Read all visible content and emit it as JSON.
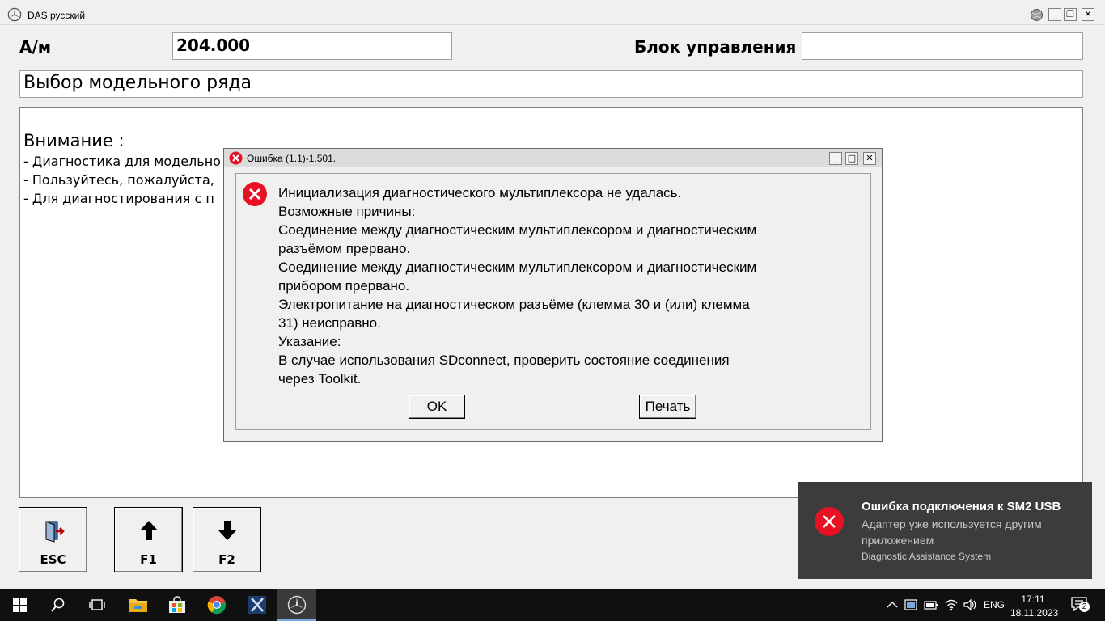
{
  "window": {
    "title": "DAS русский"
  },
  "header": {
    "am_label": "А/м",
    "am_value": "204.000",
    "block_label": "Блок управления",
    "block_value": ""
  },
  "main": {
    "section_title": "Выбор модельного ряда",
    "attention_title": "Внимание :",
    "lines": [
      "- Диагностика для модельно",
      "- Пользуйтесь, пожалуйста,",
      "- Для диагностирования с п"
    ]
  },
  "footer_buttons": {
    "esc": "ESC",
    "f1": "F1",
    "f2": "F2"
  },
  "dialog": {
    "title": "Ошибка  (1.1)-1.501.",
    "message_lines": [
      "Инициализация диагностического мультиплексора не удалась.",
      "Возможные причины:",
      "Соединение между диагностическим мультиплексором и диагностическим",
      "разъёмом прервано.",
      "Соединение между диагностическим мультиплексором и диагностическим",
      "прибором прервано.",
      "Электропитание на диагностическом разъёме (клемма 30 и (или) клемма",
      "31) неисправно.",
      "Указание:",
      "В случае использования SDconnect, проверить состояние соединения",
      "через Toolkit."
    ],
    "ok_label": "OK",
    "print_label": "Печать"
  },
  "toast": {
    "title": "Ошибка подключения к SM2 USB",
    "body": "Адаптер уже используется другим приложением",
    "source": "Diagnostic Assistance System"
  },
  "taskbar": {
    "lang": "ENG",
    "time": "17:11",
    "date": "18.11.2023",
    "notification_count": "2"
  },
  "colors": {
    "error_red": "#e81123",
    "toast_bg": "#3c3c3c",
    "taskbar_bg": "#101010"
  }
}
